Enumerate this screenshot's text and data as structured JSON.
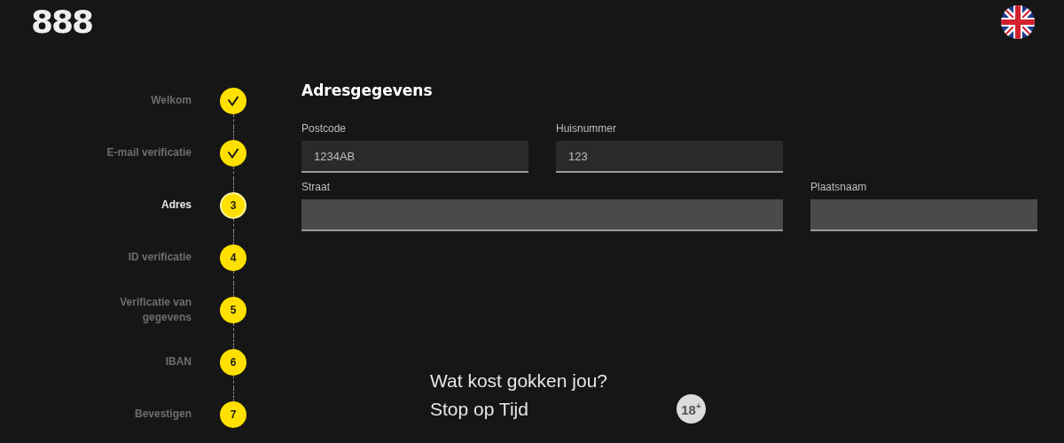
{
  "header": {
    "logo": "888"
  },
  "steps": [
    {
      "label": "Welkom",
      "kind": "done",
      "selected": false
    },
    {
      "label": "E-mail verificatie",
      "kind": "done",
      "selected": false
    },
    {
      "label": "Adres",
      "kind": "number",
      "number": "3",
      "selected": true
    },
    {
      "label": "ID verificatie",
      "kind": "number",
      "number": "4",
      "selected": false
    },
    {
      "label": "Verificatie van gegevens",
      "kind": "number",
      "number": "5",
      "selected": false
    },
    {
      "label": "IBAN",
      "kind": "number",
      "number": "6",
      "selected": false
    },
    {
      "label": "Bevestigen",
      "kind": "number",
      "number": "7",
      "selected": false
    }
  ],
  "form": {
    "title": "Adresgegevens",
    "rows": [
      [
        {
          "label": "Postcode",
          "value": "1234AB",
          "disabled": false
        },
        {
          "label": "Huisnummer",
          "value": "123",
          "disabled": false
        }
      ],
      [
        {
          "label": "Straat",
          "disabled": true,
          "wide": true
        },
        {
          "label": "Plaatsnaam",
          "disabled": true
        }
      ]
    ]
  },
  "footer": {
    "lines": [
      "Wat kost gokken jou?",
      "Stop op Tijd"
    ],
    "age_badge": "18$^{+}$"
  }
}
